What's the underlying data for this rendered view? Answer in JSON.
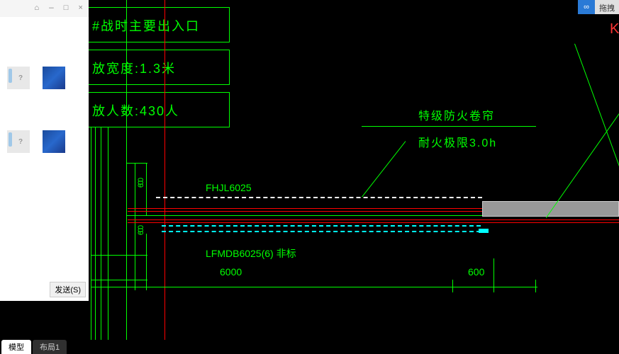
{
  "panel": {
    "send_label": "发送(S)"
  },
  "cad": {
    "label_exit": "#战时主要出入口",
    "label_width": "放宽度:1.3米",
    "label_people": "放人数:430人",
    "label_fire_curtain": "特级防火卷帘",
    "label_fire_limit": "耐火极限3.0h",
    "code_fhjl": "FHJL6025",
    "code_lfmdb": "LFMDB6025(6) 非标",
    "dim_600_a": "600",
    "dim_600_b": "600",
    "dim_6000": "6000",
    "dim_600_right": "600",
    "letter_k": "K"
  },
  "tabs": {
    "model": "模型",
    "layout1": "布局1"
  },
  "toggle": {
    "logo": "∞",
    "text": "拖拽"
  }
}
